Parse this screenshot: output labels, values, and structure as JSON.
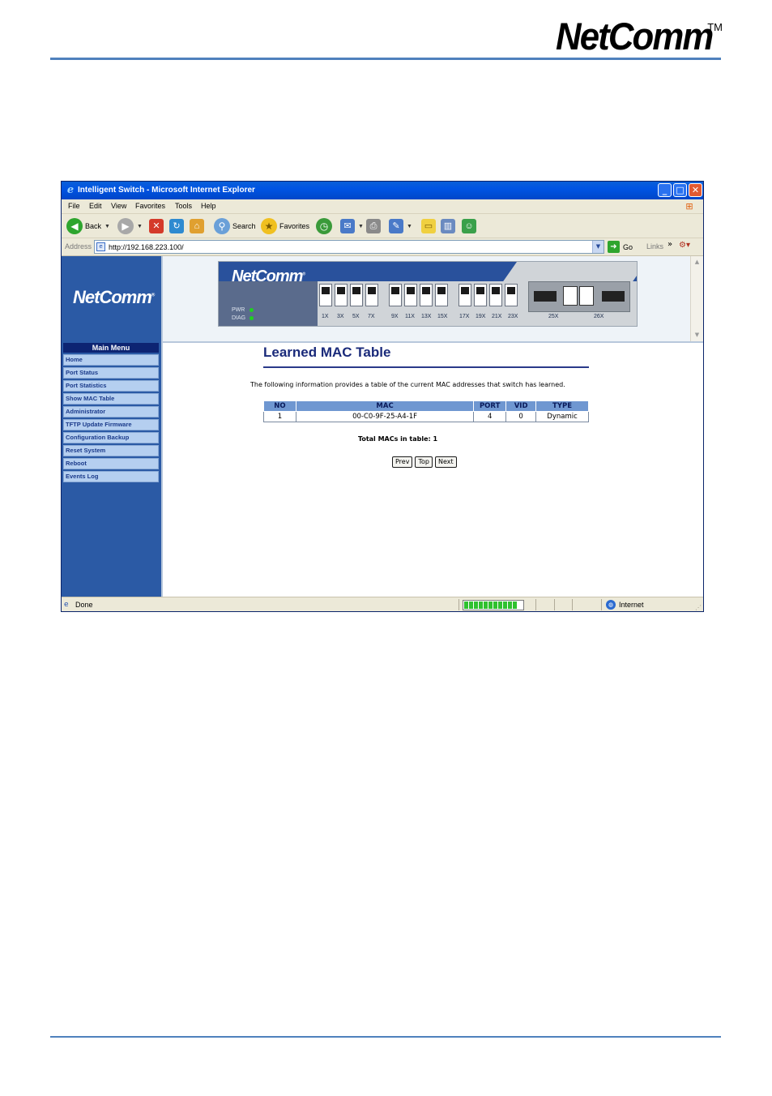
{
  "document": {
    "logo_text": "NetComm",
    "logo_tm": "TM",
    "accent_color": "#4f81bd"
  },
  "browser": {
    "title": "Intelligent Switch - Microsoft Internet Explorer",
    "window_buttons": {
      "minimize": "_",
      "maximize": "□",
      "close": "✕"
    },
    "menu": [
      "File",
      "Edit",
      "View",
      "Favorites",
      "Tools",
      "Help"
    ],
    "toolbar": {
      "back_label": "Back",
      "search_label": "Search",
      "favorites_label": "Favorites"
    },
    "address": {
      "label": "Address",
      "url": "http://192.168.223.100/",
      "go_label": "Go",
      "links_label": "Links"
    },
    "status": {
      "text": "Done",
      "zone": "Internet",
      "progress_segments": 11
    }
  },
  "page": {
    "brand": "NetComm",
    "switch_panel": {
      "brand": "NetComm",
      "led_labels": [
        "PWR",
        "DIAG"
      ],
      "port_labels": [
        "1X",
        "3X",
        "5X",
        "7X",
        "9X",
        "11X",
        "13X",
        "15X",
        "17X",
        "19X",
        "21X",
        "23X",
        "25X",
        "26X"
      ]
    },
    "sidebar": {
      "header": "Main Menu",
      "items": [
        "Home",
        "Port Status",
        "Port Statistics",
        "Show MAC Table",
        "Administrator",
        "TFTP Update Firmware",
        "Configuration Backup",
        "Reset System",
        "Reboot",
        "Events Log"
      ]
    },
    "main": {
      "title": "Learned MAC Table",
      "description": "The following information provides a table of the current MAC addresses that switch has learned.",
      "table": {
        "headers": [
          "NO",
          "MAC",
          "PORT",
          "VID",
          "TYPE"
        ],
        "rows": [
          [
            "1",
            "00-C0-9F-25-A4-1F",
            "4",
            "0",
            "Dynamic"
          ]
        ]
      },
      "total_text": "Total MACs in table: 1",
      "buttons": {
        "prev": "Prev",
        "top": "Top",
        "next": "Next"
      }
    }
  }
}
